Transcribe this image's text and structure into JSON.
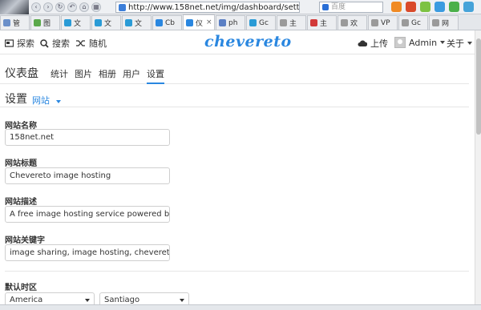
{
  "browser": {
    "url": "http://www.158net.net/img/dashboard/setting",
    "search_placeholder": "百度",
    "tabs": [
      {
        "label": "管",
        "color": "#6a8fc9"
      },
      {
        "label": "图",
        "color": "#5aa84b"
      },
      {
        "label": "文",
        "color": "#2a9bd6"
      },
      {
        "label": "文",
        "color": "#2a9bd6"
      },
      {
        "label": "文",
        "color": "#2a9bd6"
      },
      {
        "label": "Cb",
        "color": "#2a87e0"
      },
      {
        "label": "仪",
        "color": "#2a87e0",
        "active": true
      },
      {
        "label": "ph",
        "color": "#5a7fc4"
      },
      {
        "label": "Gc",
        "color": "#2a9bd6"
      },
      {
        "label": "主",
        "color": "#9a9a9a"
      },
      {
        "label": "主",
        "color": "#d23a3a"
      },
      {
        "label": "欢",
        "color": "#9a9a9a"
      },
      {
        "label": "VP",
        "color": "#9a9a9a"
      },
      {
        "label": "Gc",
        "color": "#9a9a9a"
      },
      {
        "label": "网",
        "color": "#9a9a9a"
      }
    ],
    "ext_colors": [
      "#f08a24",
      "#d94a2b",
      "#7cc242",
      "#3a9be0",
      "#4ab04a",
      "#46a3d9"
    ]
  },
  "header": {
    "explore": "探索",
    "search": "搜索",
    "random": "随机",
    "logo": "chevereto",
    "upload": "上传",
    "user": "Admin",
    "about": "关于"
  },
  "dashboard": {
    "title": "仪表盘",
    "tabs": [
      "统计",
      "图片",
      "相册",
      "用户",
      "设置"
    ],
    "active_tab": "设置"
  },
  "settings": {
    "title": "设置",
    "section": "网站"
  },
  "form": {
    "site_name_label": "网站名称",
    "site_name": "158net.net",
    "site_title_label": "网站标题",
    "site_title": "Chevereto image hosting",
    "site_desc_label": "网站描述",
    "site_desc": "A free image hosting service powered by Chevereto",
    "site_keywords_label": "网站关键字",
    "site_keywords": "image sharing, image hosting, chevereto",
    "timezone_label": "默认时区",
    "timezone_region": "America",
    "timezone_city": "Santiago"
  }
}
